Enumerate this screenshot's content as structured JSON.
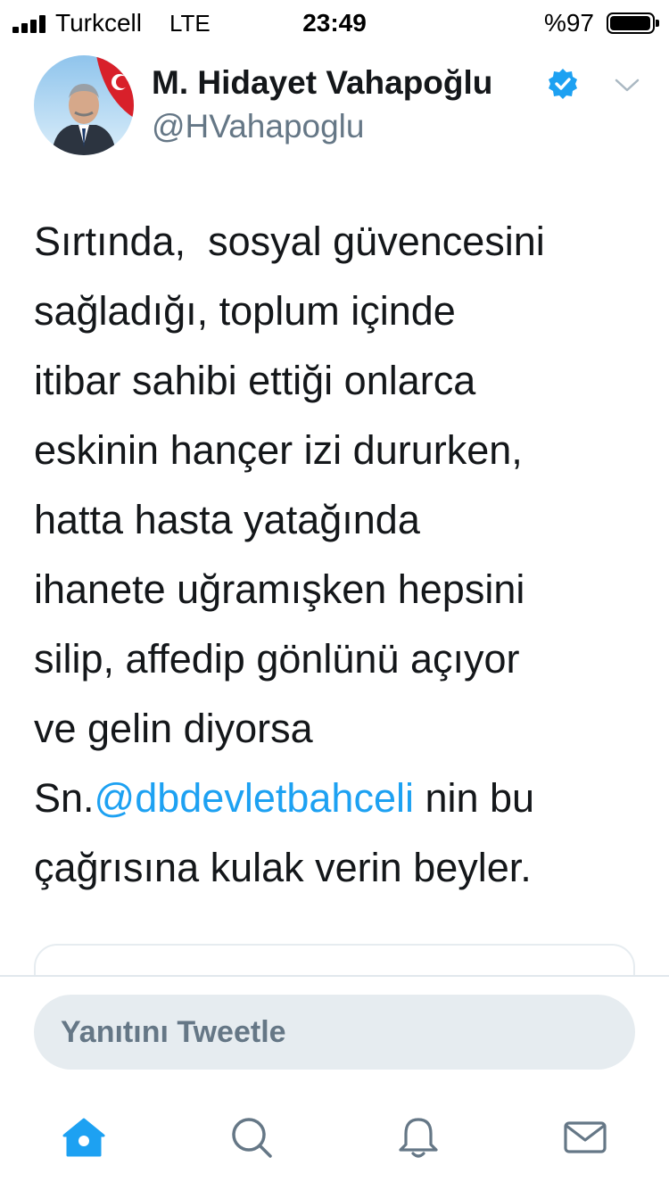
{
  "status_bar": {
    "carrier": "Turkcell",
    "network": "LTE",
    "time": "23:49",
    "battery_percent": "%97",
    "battery_level": 0.97
  },
  "tweet": {
    "author_name": "M. Hidayet Vahapoğlu",
    "handle": "@HVahapoglu",
    "verified": true,
    "text_lines": [
      "Sırtında,  sosyal güvencesini",
      "sağladığı, toplum içinde",
      "itibar sahibi ettiği onlarca",
      "eskinin hançer izi dururken,",
      "hatta hasta yatağında",
      "ihanete uğramışken hepsini",
      "silip, affedip gönlünü açıyor",
      "ve gelin diyorsa"
    ],
    "line9": {
      "prefix": "Sn.",
      "mention": "@dbdevletbahceli",
      "suffix": " nin bu"
    },
    "line10": "çağrısına kulak verin beyler."
  },
  "reply": {
    "placeholder": "Yanıtını Tweetle"
  },
  "tabs": [
    {
      "icon": "home-icon",
      "active": true
    },
    {
      "icon": "search-icon",
      "active": false
    },
    {
      "icon": "bell-icon",
      "active": false
    },
    {
      "icon": "mail-icon",
      "active": false
    }
  ],
  "colors": {
    "accent": "#1da1f2",
    "text": "#14171a",
    "secondary": "#657786",
    "reply_bg": "#e6ecf0"
  }
}
